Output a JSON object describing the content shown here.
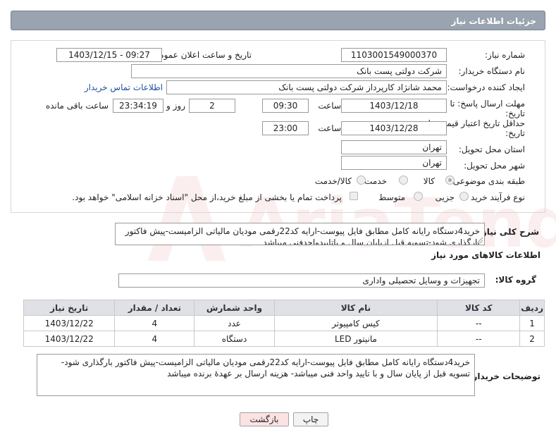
{
  "header": {
    "title": "جزئیات اطلاعات نیاز"
  },
  "form": {
    "need_number_label": "شماره نیاز:",
    "need_number": "1103001549000370",
    "announce_label": "تاریخ و ساعت اعلان عمومی:",
    "announce_value": "1403/12/15 - 09:27",
    "buyer_org_label": "نام دستگاه خریدار:",
    "buyer_org": "شرکت دولتی پست بانک",
    "requester_label": "ایجاد کننده درخواست:",
    "requester": "محمد شانژاد کارپرداز شرکت دولتی پست بانک",
    "contact_link": "اطلاعات تماس خریدار",
    "deadline_label_1": "مهلت ارسال پاسخ: تا",
    "deadline_label_2": "تاریخ:",
    "deadline_date": "1403/12/18",
    "hour_label": "ساعت",
    "deadline_time": "09:30",
    "days_value": "2",
    "days_label": "روز و",
    "remaining_time": "23:34:19",
    "remaining_label": "ساعت باقی مانده",
    "validity_label_1": "حداقل تاریخ اعتبار قیمت: تا",
    "validity_label_2": "تاریخ:",
    "validity_date": "1403/12/28",
    "validity_time": "23:00",
    "province_label": "استان محل تحویل:",
    "province": "تهران",
    "city_label": "شهر محل تحویل:",
    "city": "تهران",
    "category_label": "طبقه بندی موضوعی:",
    "category_options": [
      "کالا",
      "خدمت",
      "کالا/خدمت"
    ],
    "process_label": "نوع فرآیند خرید :",
    "process_options": [
      "جزیی",
      "متوسط"
    ],
    "payment_note": "پرداخت تمام یا بخشی از مبلغ خرید،از محل \"اسناد خزانه اسلامی\" خواهد بود."
  },
  "description": {
    "label": "شرح کلی نیاز:",
    "text": "خرید4دستگاه رایانه کامل مطابق فایل پیوست-ارایه کد22رقمی مودیان مالیاتی الزامیست-پیش فاکتور بارگذاری شود-تسویه قبل ازپایان سال و باتاییدواحدفنی میباشد"
  },
  "goods": {
    "section_title": "اطلاعات کالاهای مورد نیاز",
    "group_label": "گروه کالا:",
    "group_value": "تجهیزات و وسایل تحصیلی واداری",
    "columns": [
      "ردیف",
      "کد کالا",
      "نام کالا",
      "واحد شمارش",
      "تعداد / مقدار",
      "تاریخ نیاز"
    ],
    "rows": [
      {
        "row": "1",
        "code": "--",
        "name": "کیس کامپیوتر",
        "unit": "عدد",
        "qty": "4",
        "date": "1403/12/22"
      },
      {
        "row": "2",
        "code": "--",
        "name": "مانیتور LED",
        "unit": "دستگاه",
        "qty": "4",
        "date": "1403/12/22"
      }
    ]
  },
  "buyer_notes": {
    "label": "توضیحات خریدار:",
    "text": "خرید4دستگاه رایانه کامل مطابق فایل پیوست-ارایه کد22رقمی مودیان مالیاتی الزامیست-پیش فاکتور بارگذاری شود-تسویه قبل از پایان سال و با تایید واحد فنی میباشد- هزینه ارسال بر عهدهٔ برنده میباشد"
  },
  "buttons": {
    "print": "چاپ",
    "back": "بازگشت"
  },
  "watermark": {
    "text": "AriaTender.neT"
  },
  "colors": {
    "header_bg": "#9aa3b0",
    "table_header_bg": "#dfe1e6",
    "link": "#1f4fa3",
    "back_btn_bg": "#fbe3e3"
  }
}
